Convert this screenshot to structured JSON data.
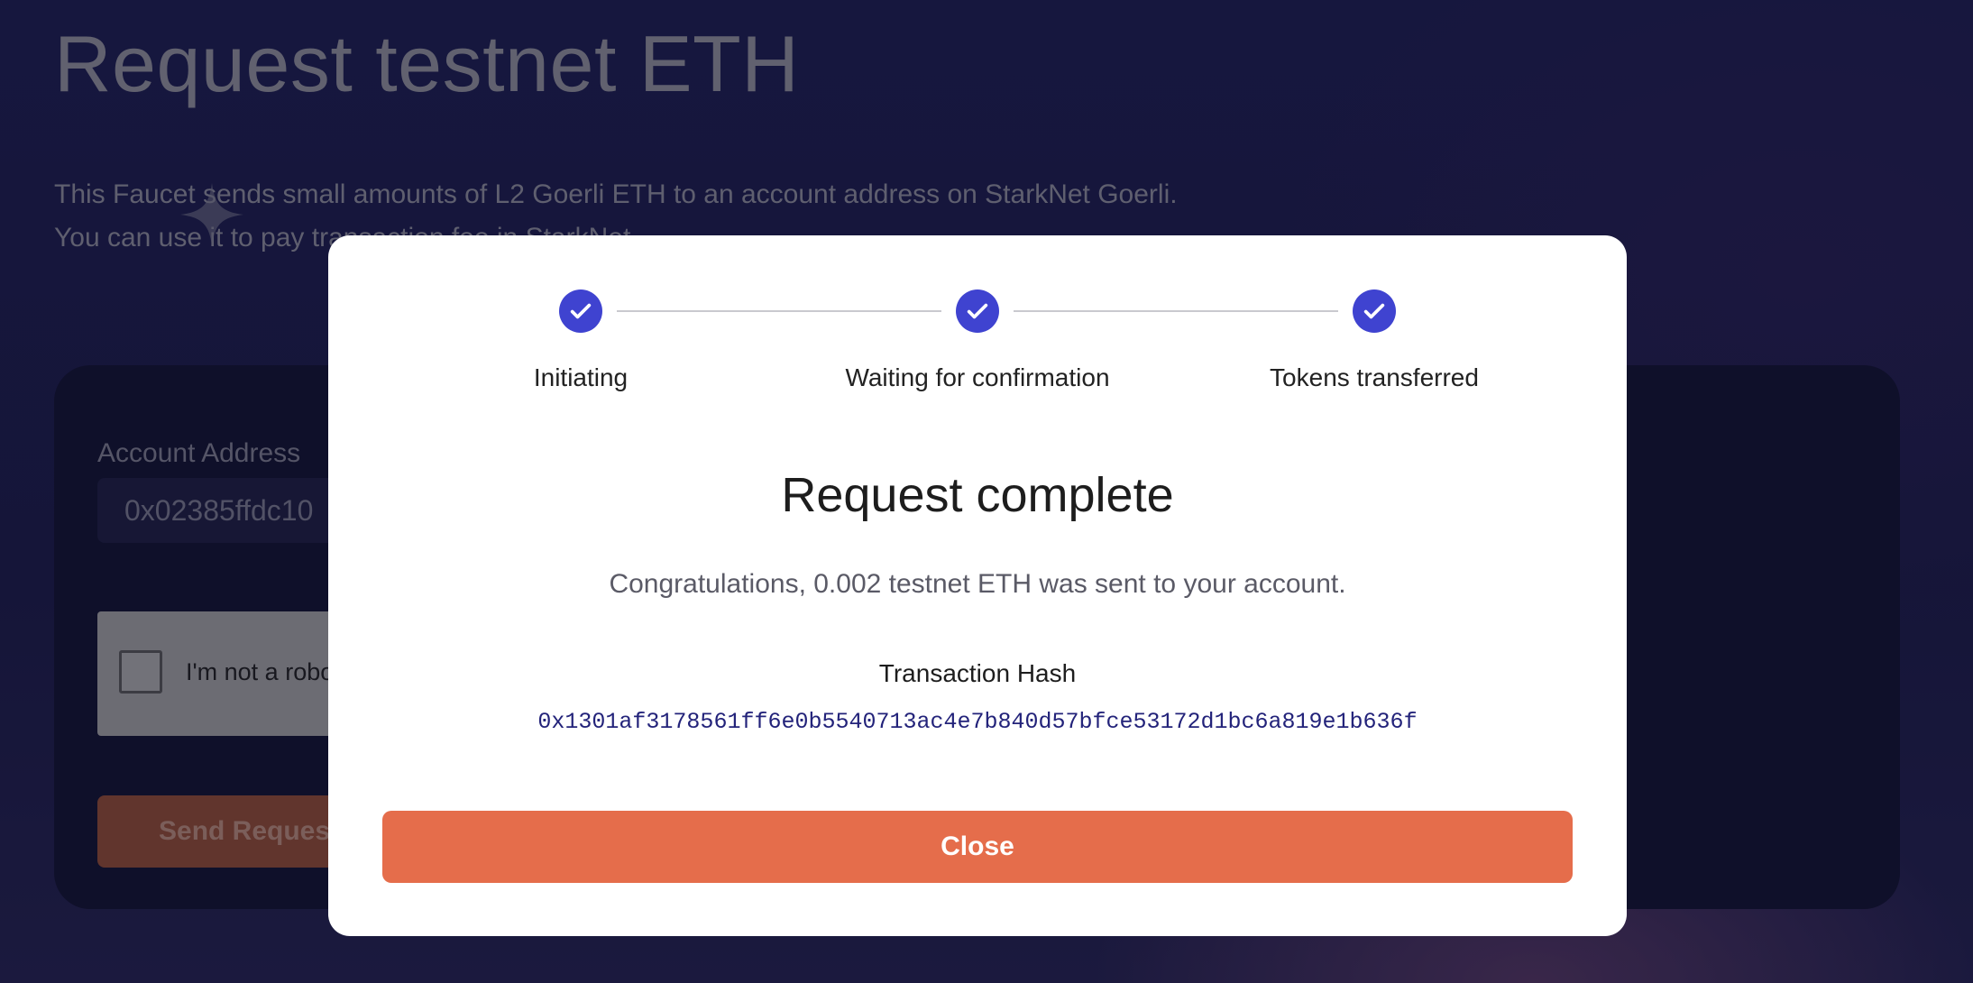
{
  "page": {
    "title": "Request testnet ETH",
    "description_lines": [
      "This Faucet sends small amounts of L2 Goerli ETH to an account address on StarkNet Goerli.",
      "You can use it to pay transaction fee in StarkNet."
    ]
  },
  "form": {
    "account_label": "Account Address",
    "account_value": "0x02385ffdc10",
    "captcha_label": "I'm not a robot",
    "send_label": "Send Request"
  },
  "modal": {
    "steps": [
      {
        "label": "Initiating",
        "status": "complete",
        "icon": "check-icon"
      },
      {
        "label": "Waiting for confirmation",
        "status": "complete",
        "icon": "check-icon"
      },
      {
        "label": "Tokens transferred",
        "status": "complete",
        "icon": "check-icon"
      }
    ],
    "title": "Request complete",
    "message": "Congratulations, 0.002 testnet ETH was sent to your account.",
    "hash_label": "Transaction Hash",
    "hash_value": "0x1301af3178561ff6e0b5540713ac4e7b840d57bfce53172d1bc6a819e1b636f",
    "close_label": "Close"
  },
  "colors": {
    "accent": "#3f43d0",
    "button": "#e56d4b",
    "background": "#1b1c4a"
  }
}
